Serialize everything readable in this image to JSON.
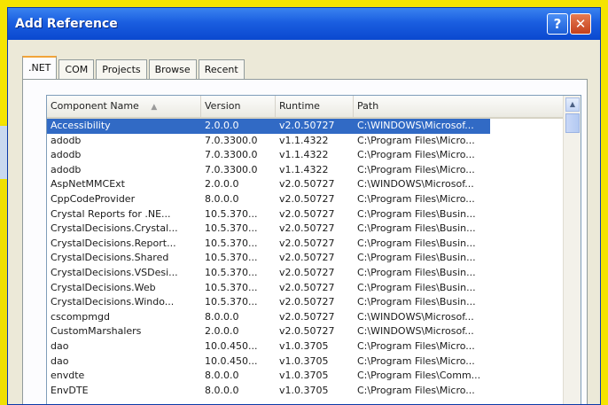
{
  "window": {
    "title": "Add Reference"
  },
  "titlebar": {
    "help_label": "?",
    "close_label": "✕"
  },
  "tabs": [
    {
      "label": ".NET",
      "active": true
    },
    {
      "label": "COM"
    },
    {
      "label": "Projects"
    },
    {
      "label": "Browse"
    },
    {
      "label": "Recent"
    }
  ],
  "columns": {
    "name": "Component Name",
    "version": "Version",
    "runtime": "Runtime",
    "path": "Path"
  },
  "sort_indicator": "▲",
  "rows": [
    {
      "name": "Accessibility",
      "version": "2.0.0.0",
      "runtime": "v2.0.50727",
      "path": "C:\\WINDOWS\\Microsof..."
    },
    {
      "name": "adodb",
      "version": "7.0.3300.0",
      "runtime": "v1.1.4322",
      "path": "C:\\Program Files\\Micro..."
    },
    {
      "name": "adodb",
      "version": "7.0.3300.0",
      "runtime": "v1.1.4322",
      "path": "C:\\Program Files\\Micro..."
    },
    {
      "name": "adodb",
      "version": "7.0.3300.0",
      "runtime": "v1.1.4322",
      "path": "C:\\Program Files\\Micro..."
    },
    {
      "name": "AspNetMMCExt",
      "version": "2.0.0.0",
      "runtime": "v2.0.50727",
      "path": "C:\\WINDOWS\\Microsof..."
    },
    {
      "name": "CppCodeProvider",
      "version": "8.0.0.0",
      "runtime": "v2.0.50727",
      "path": "C:\\Program Files\\Micro..."
    },
    {
      "name": "Crystal Reports for .NE...",
      "version": "10.5.370...",
      "runtime": "v2.0.50727",
      "path": "C:\\Program Files\\Busin..."
    },
    {
      "name": "CrystalDecisions.Crystal...",
      "version": "10.5.370...",
      "runtime": "v2.0.50727",
      "path": "C:\\Program Files\\Busin..."
    },
    {
      "name": "CrystalDecisions.Report...",
      "version": "10.5.370...",
      "runtime": "v2.0.50727",
      "path": "C:\\Program Files\\Busin..."
    },
    {
      "name": "CrystalDecisions.Shared",
      "version": "10.5.370...",
      "runtime": "v2.0.50727",
      "path": "C:\\Program Files\\Busin..."
    },
    {
      "name": "CrystalDecisions.VSDesi...",
      "version": "10.5.370...",
      "runtime": "v2.0.50727",
      "path": "C:\\Program Files\\Busin..."
    },
    {
      "name": "CrystalDecisions.Web",
      "version": "10.5.370...",
      "runtime": "v2.0.50727",
      "path": "C:\\Program Files\\Busin..."
    },
    {
      "name": "CrystalDecisions.Windo...",
      "version": "10.5.370...",
      "runtime": "v2.0.50727",
      "path": "C:\\Program Files\\Busin..."
    },
    {
      "name": "cscompmgd",
      "version": "8.0.0.0",
      "runtime": "v2.0.50727",
      "path": "C:\\WINDOWS\\Microsof..."
    },
    {
      "name": "CustomMarshalers",
      "version": "2.0.0.0",
      "runtime": "v2.0.50727",
      "path": "C:\\WINDOWS\\Microsof..."
    },
    {
      "name": "dao",
      "version": "10.0.450...",
      "runtime": "v1.0.3705",
      "path": "C:\\Program Files\\Micro..."
    },
    {
      "name": "dao",
      "version": "10.0.450...",
      "runtime": "v1.0.3705",
      "path": "C:\\Program Files\\Micro..."
    },
    {
      "name": "envdte",
      "version": "8.0.0.0",
      "runtime": "v1.0.3705",
      "path": "C:\\Program Files\\Comm..."
    },
    {
      "name": "EnvDTE",
      "version": "8.0.0.0",
      "runtime": "v1.0.3705",
      "path": "C:\\Program Files\\Micro..."
    }
  ],
  "selected_row": 0,
  "colors": {
    "selection": "#316ac5",
    "titlebar": "#0a48cf"
  }
}
